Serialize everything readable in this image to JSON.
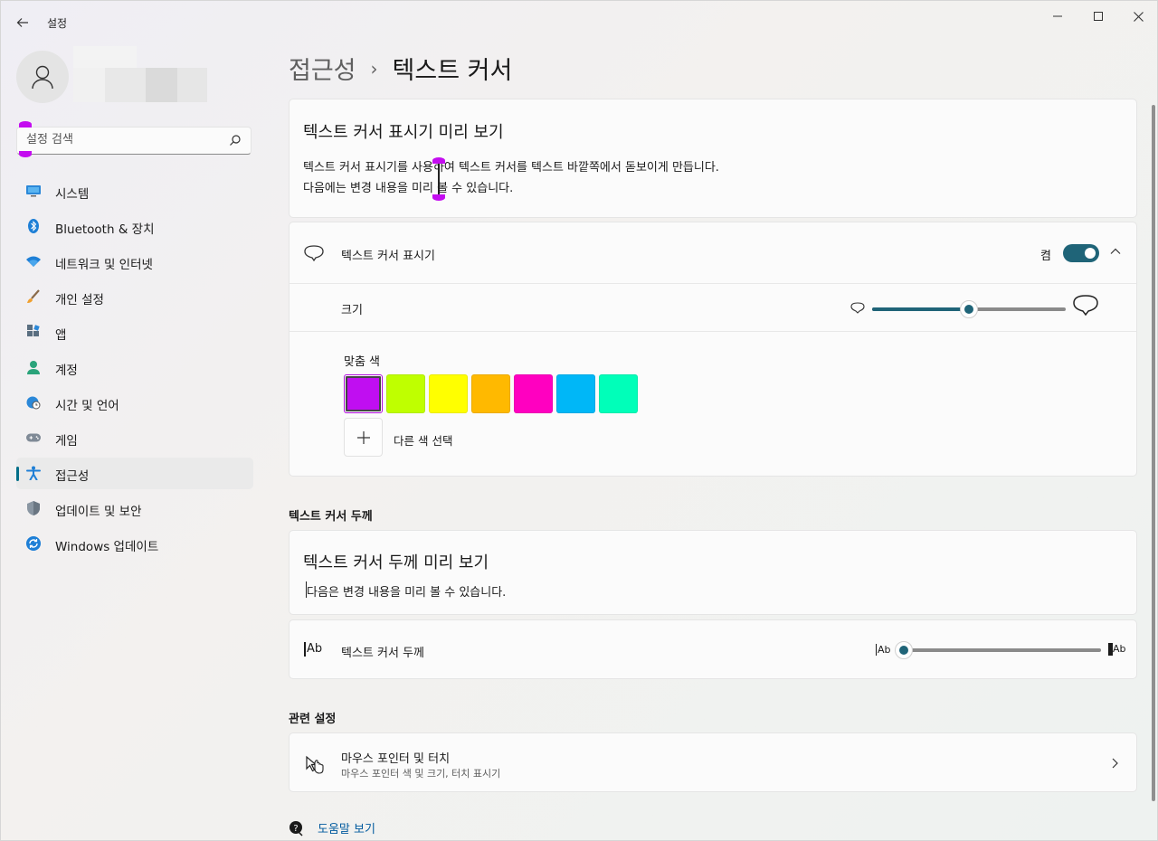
{
  "titlebar": {
    "app_title": "설정",
    "back_icon": "back-arrow-icon",
    "minimize_icon": "minimize-icon",
    "maximize_icon": "maximize-icon",
    "close_icon": "close-icon"
  },
  "search": {
    "placeholder": "설정 검색",
    "icon": "search-icon"
  },
  "sidebar": {
    "items": [
      {
        "label": "시스템",
        "icon": "system-monitor-icon"
      },
      {
        "label": "Bluetooth & 장치",
        "icon": "bluetooth-icon"
      },
      {
        "label": "네트워크 및 인터넷",
        "icon": "wifi-icon"
      },
      {
        "label": "개인 설정",
        "icon": "brush-icon"
      },
      {
        "label": "앱",
        "icon": "apps-icon"
      },
      {
        "label": "계정",
        "icon": "account-icon"
      },
      {
        "label": "시간 및 언어",
        "icon": "globe-clock-icon"
      },
      {
        "label": "게임",
        "icon": "gamepad-icon"
      },
      {
        "label": "접근성",
        "icon": "accessibility-icon",
        "active": true
      },
      {
        "label": "업데이트 및 보안",
        "icon": "shield-icon"
      },
      {
        "label": "Windows 업데이트",
        "icon": "update-icon"
      }
    ]
  },
  "breadcrumb": {
    "parent": "접근성",
    "separator": "›",
    "current": "텍스트 커서"
  },
  "preview_card": {
    "title": "텍스트 커서 표시기 미리 보기",
    "description": "텍스트 커서 표시기를 사용하여 텍스트 커서를 텍스트 바깥쪽에서 돋보이게 만듭니다. 다음에는 변경 내용을 미리 볼 수 있습니다."
  },
  "indicator_card": {
    "label": "텍스트 커서 표시기",
    "icon": "cursor-indicator-icon",
    "toggle_state": "켬",
    "toggle_on": true,
    "size_label": "크기",
    "size_value": 0.5,
    "colors_label": "맞춤 색",
    "swatches": [
      "#c00ef1",
      "#bfff00",
      "#ffff00",
      "#ffb900",
      "#ff00c0",
      "#00b7f7",
      "#00ffb9"
    ],
    "selected_swatch": 0,
    "add_color_label": "다른 색 선택"
  },
  "thickness_section": {
    "title": "텍스트 커서 두께",
    "preview_title": "텍스트 커서 두께 미리 보기",
    "preview_desc": "다음은 변경 내용을 미리 볼 수 있습니다.",
    "label": "텍스트 커서 두께",
    "ab_text": "Ab",
    "thickness_value": 0.0
  },
  "related_section": {
    "title": "관련 설정",
    "item_title": "마우스 포인터 및 터치",
    "item_sub": "마우스 포인터 색 및 크기, 터치 표시기"
  },
  "help": {
    "label": "도움말 보기",
    "icon": "help-icon"
  },
  "colors": {
    "accent": "#1f6478",
    "link": "#005a9e"
  }
}
